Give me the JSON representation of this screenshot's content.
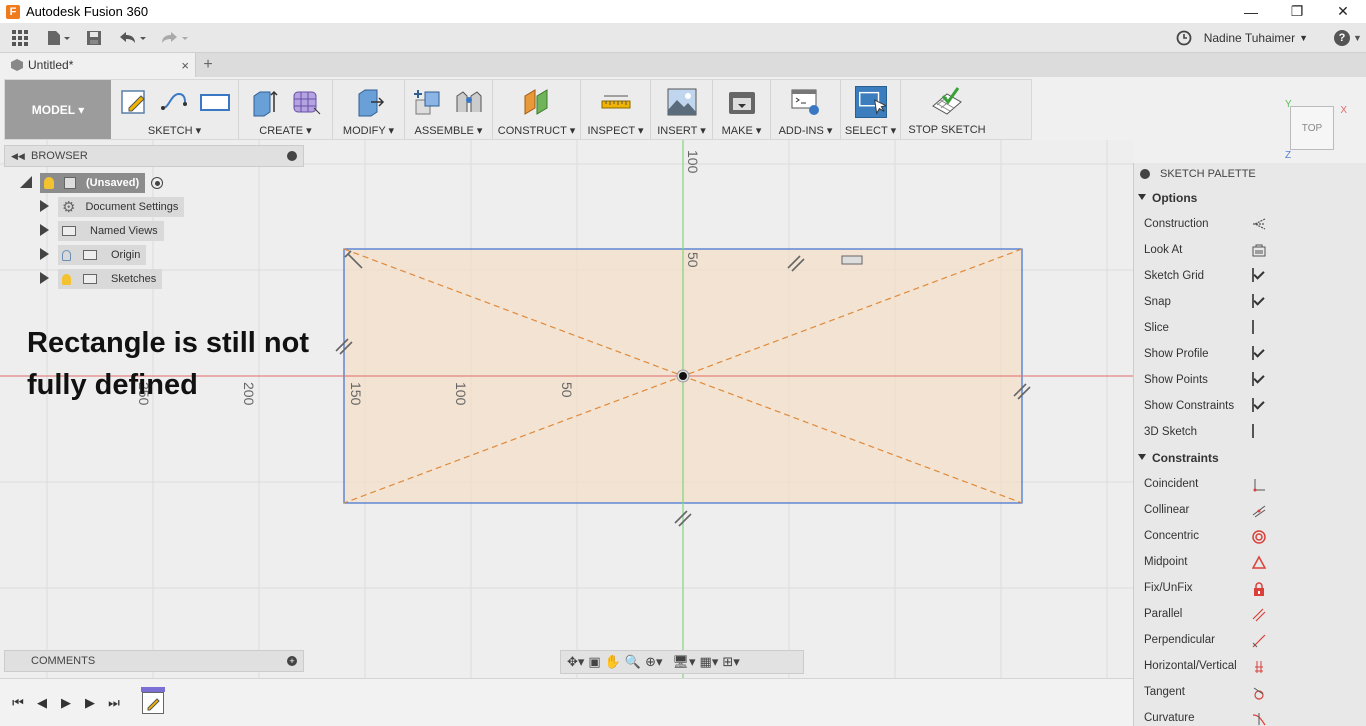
{
  "window": {
    "title": "Autodesk Fusion 360",
    "logo_letter": "F",
    "controls": {
      "minimize": "—",
      "restore": "❐",
      "close": "✕"
    }
  },
  "qat": {
    "user_name": "Nadine Tuhaimer",
    "user_caret": "▼",
    "help": "?"
  },
  "tabs": {
    "active": "Untitled*",
    "close": "×",
    "add": "+"
  },
  "ribbon": {
    "workspace": "MODEL ▾",
    "groups": [
      {
        "label": "SKETCH ▾"
      },
      {
        "label": "CREATE ▾"
      },
      {
        "label": "MODIFY ▾"
      },
      {
        "label": "ASSEMBLE ▾"
      },
      {
        "label": "CONSTRUCT ▾"
      },
      {
        "label": "INSPECT ▾"
      },
      {
        "label": "INSERT ▾"
      },
      {
        "label": "MAKE ▾"
      },
      {
        "label": "ADD-INS ▾"
      },
      {
        "label": "SELECT ▾"
      },
      {
        "label": "STOP SKETCH"
      }
    ]
  },
  "browser": {
    "title": "BROWSER",
    "root": "(Unsaved)",
    "items": [
      "Document Settings",
      "Named Views",
      "Origin",
      "Sketches"
    ]
  },
  "annotation": {
    "line1": "Rectangle is still not",
    "line2": "fully defined"
  },
  "canvas": {
    "labels": {
      "v100": "100",
      "v50": "50",
      "h150": "150",
      "h100": "100",
      "h50": "50",
      "h200": "200",
      "h250": "250"
    }
  },
  "comments": {
    "title": "COMMENTS"
  },
  "viewcube": {
    "face": "TOP",
    "axis_x": "X",
    "axis_y": "Y",
    "axis_z": "Z"
  },
  "palette": {
    "title": "SKETCH PALETTE",
    "options_header": "Options",
    "options": [
      {
        "label": "Construction",
        "type": "icon",
        "icon": "construction-icon"
      },
      {
        "label": "Look At",
        "type": "icon",
        "icon": "look-at-icon"
      },
      {
        "label": "Sketch Grid",
        "type": "check",
        "checked": true
      },
      {
        "label": "Snap",
        "type": "check",
        "checked": true
      },
      {
        "label": "Slice",
        "type": "check",
        "checked": false
      },
      {
        "label": "Show Profile",
        "type": "check",
        "checked": true
      },
      {
        "label": "Show Points",
        "type": "check",
        "checked": true
      },
      {
        "label": "Show Constraints",
        "type": "check",
        "checked": true
      },
      {
        "label": "3D Sketch",
        "type": "check",
        "checked": false
      }
    ],
    "constraints_header": "Constraints",
    "constraints": [
      {
        "label": "Coincident",
        "icon": "coincident-icon"
      },
      {
        "label": "Collinear",
        "icon": "collinear-icon"
      },
      {
        "label": "Concentric",
        "icon": "concentric-icon"
      },
      {
        "label": "Midpoint",
        "icon": "midpoint-icon"
      },
      {
        "label": "Fix/UnFix",
        "icon": "lock-icon"
      },
      {
        "label": "Parallel",
        "icon": "parallel-icon"
      },
      {
        "label": "Perpendicular",
        "icon": "perpendicular-icon"
      },
      {
        "label": "Horizontal/Vertical",
        "icon": "horizontal-vertical-icon"
      },
      {
        "label": "Tangent",
        "icon": "tangent-icon"
      },
      {
        "label": "Curvature",
        "icon": "curvature-icon"
      }
    ]
  },
  "colors": {
    "accent": "#3b7dbd",
    "profile_fill": "#f3dfc8",
    "construction": "#e08a3a",
    "constraint_red": "#d9403a"
  }
}
